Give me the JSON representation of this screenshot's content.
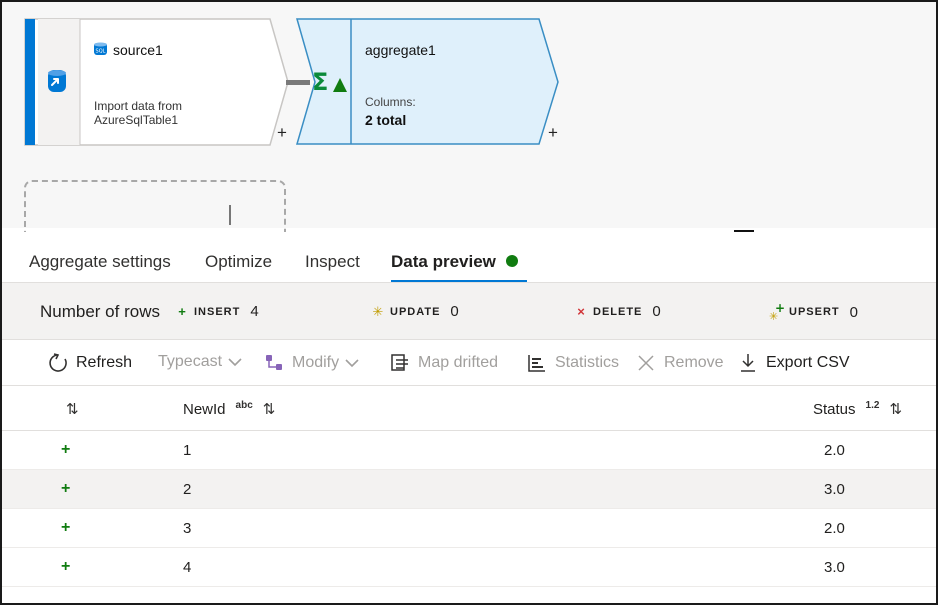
{
  "canvas": {
    "source_node": {
      "title": "source1",
      "description_line1": "Import data from",
      "description_line2": "AzureSqlTable1",
      "plus": "+"
    },
    "aggregate_node": {
      "title": "aggregate1",
      "columns_label": "Columns:",
      "columns_value": "2 total",
      "plus": "+"
    },
    "colors": {
      "accent": "#0078d4",
      "aggregate_fill": "#dff0fb",
      "aggregate_border": "#3a8ec4"
    }
  },
  "tabs": [
    {
      "label": "Aggregate settings"
    },
    {
      "label": "Optimize"
    },
    {
      "label": "Inspect"
    },
    {
      "label": "Data preview",
      "active": true,
      "status_color": "#107c10"
    }
  ],
  "counts": {
    "label": "Number of rows",
    "insert": {
      "icon": "+",
      "label": "INSERT",
      "value": "4"
    },
    "update": {
      "icon": "✳",
      "label": "UPDATE",
      "value": "0"
    },
    "delete": {
      "icon": "×",
      "label": "DELETE",
      "value": "0"
    },
    "upsert": {
      "icon": "upsert-icon",
      "label": "UPSERT",
      "value": "0"
    }
  },
  "toolbar": {
    "refresh": "Refresh",
    "typecast": "Typecast",
    "modify": "Modify",
    "map_drifted": "Map drifted",
    "statistics": "Statistics",
    "remove": "Remove",
    "export_csv": "Export CSV"
  },
  "table": {
    "columns": [
      {
        "name": "NewId",
        "type": "abc"
      },
      {
        "name": "Status",
        "type": "1.2"
      }
    ],
    "sort_glyph": "⇅",
    "row_marker": "+",
    "rows": [
      {
        "newid": "1",
        "status": "2.0"
      },
      {
        "newid": "2",
        "status": "3.0"
      },
      {
        "newid": "3",
        "status": "2.0"
      },
      {
        "newid": "4",
        "status": "3.0"
      }
    ]
  }
}
